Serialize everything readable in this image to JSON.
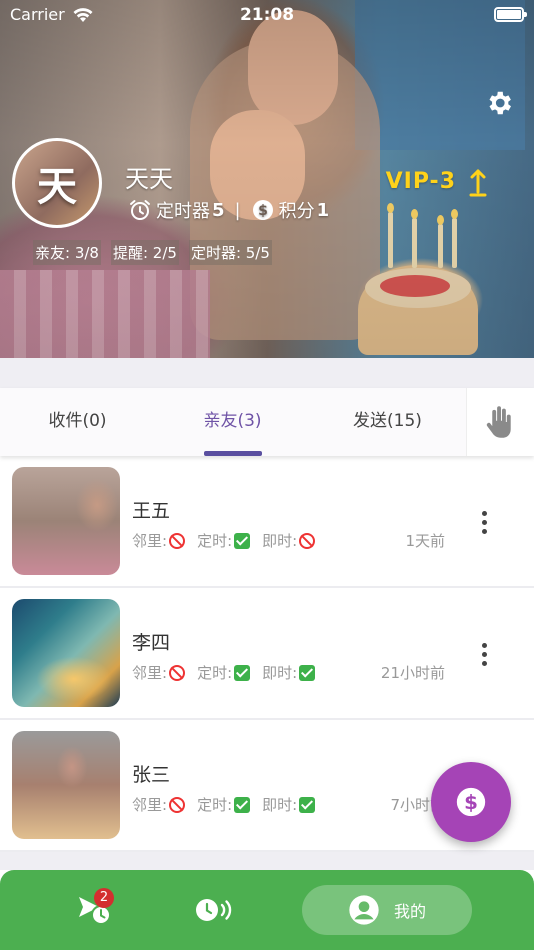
{
  "status_bar": {
    "carrier": "Carrier",
    "time": "21:08"
  },
  "profile": {
    "avatar_text": "天",
    "name": "天天",
    "timer_label": "定时器",
    "timer_count": "5",
    "points_label": "积分",
    "points_count": "1",
    "separator": "|",
    "vip_level": "VIP-3",
    "quotas": [
      "亲友: 3/8",
      "提醒: 2/5",
      "定时器: 5/5"
    ]
  },
  "tabs": [
    {
      "label": "收件(0)",
      "active": false
    },
    {
      "label": "亲友(3)",
      "active": true
    },
    {
      "label": "发送(15)",
      "active": false
    }
  ],
  "list_labels": {
    "neighbor": "邻里:",
    "scheduled": "定时:",
    "instant": "即时:"
  },
  "friends": [
    {
      "name": "王五",
      "neighbor": "off",
      "scheduled": "on",
      "instant": "off",
      "time": "1天前",
      "thumb": "photo-mother-child"
    },
    {
      "name": "李四",
      "neighbor": "off",
      "scheduled": "on",
      "instant": "on",
      "time": "21小时前",
      "thumb": "photo-ocean-wave"
    },
    {
      "name": "张三",
      "neighbor": "off",
      "scheduled": "on",
      "instant": "on",
      "time": "7小时前",
      "thumb": "photo-birthday-cake"
    }
  ],
  "bottom_nav": {
    "badge_count": "2",
    "me_label": "我的"
  },
  "colors": {
    "accent_purple": "#6f53a6",
    "fab": "#a544b6",
    "nav_green": "#4caf50",
    "vip_gold": "#ffd21a",
    "badge_red": "#d32f2f"
  }
}
